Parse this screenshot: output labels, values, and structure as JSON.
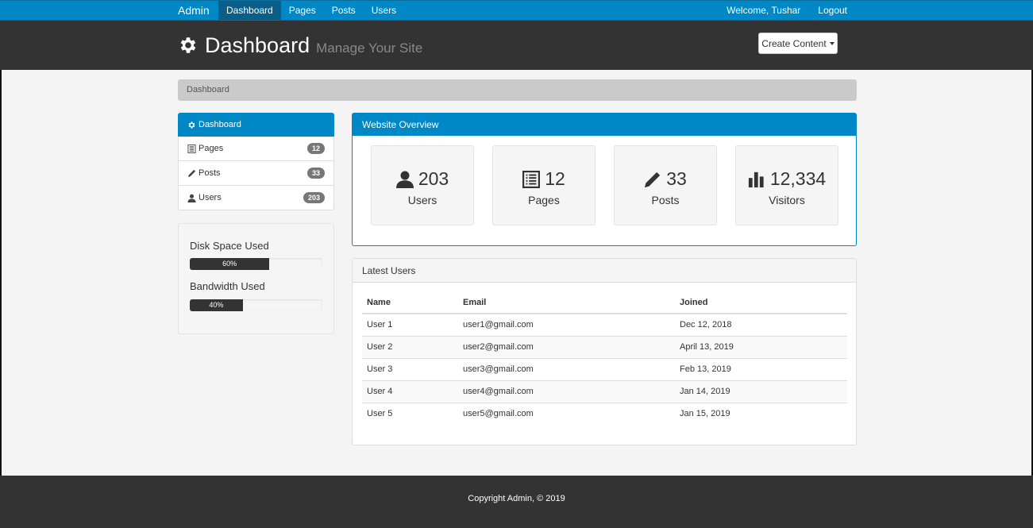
{
  "navbar": {
    "brand": "Admin",
    "links": [
      {
        "label": "Dashboard",
        "active": true
      },
      {
        "label": "Pages",
        "active": false
      },
      {
        "label": "Posts",
        "active": false
      },
      {
        "label": "Users",
        "active": false
      }
    ],
    "welcome": "Welcome, Tushar",
    "logout": "Logout"
  },
  "header": {
    "icon": "gear-icon",
    "title": "Dashboard",
    "subtitle": "Manage Your Site",
    "create_button": "Create Content"
  },
  "breadcrumb": "Dashboard",
  "sidebar": {
    "items": [
      {
        "label": "Dashboard",
        "icon": "gear-icon"
      },
      {
        "label": "Pages",
        "icon": "list-icon",
        "count": "12"
      },
      {
        "label": "Posts",
        "icon": "pencil-icon",
        "count": "33"
      },
      {
        "label": "Users",
        "icon": "user-icon",
        "count": "203"
      }
    ],
    "disk": {
      "label": "Disk Space Used",
      "value": "60%",
      "percent": 60
    },
    "bandwidth": {
      "label": "Bandwidth Used",
      "value": "40%",
      "percent": 40
    }
  },
  "overview": {
    "title": "Website Overview",
    "stats": [
      {
        "value": "203",
        "label": "Users",
        "icon": "user-icon"
      },
      {
        "value": "12",
        "label": "Pages",
        "icon": "list-icon"
      },
      {
        "value": "33",
        "label": "Posts",
        "icon": "pencil-icon"
      },
      {
        "value": "12,334",
        "label": "Visitors",
        "icon": "bar-chart-icon"
      }
    ]
  },
  "latest_users": {
    "title": "Latest Users",
    "columns": [
      "Name",
      "Email",
      "Joined"
    ],
    "rows": [
      [
        "User 1",
        "user1@gmail.com",
        "Dec 12, 2018"
      ],
      [
        "User 2",
        "user2@gmail.com",
        "April 13, 2019"
      ],
      [
        "User 3",
        "user3@gmail.com",
        "Feb 13, 2019"
      ],
      [
        "User 4",
        "user4@gmail.com",
        "Jan 14, 2019"
      ],
      [
        "User 5",
        "user5@gmail.com",
        "Jan 15, 2019"
      ]
    ]
  },
  "footer": "Copyright Admin, © 2019",
  "colors": {
    "primary": "#0088c6",
    "dark": "#333333",
    "breadcrumb": "#cacaca"
  }
}
